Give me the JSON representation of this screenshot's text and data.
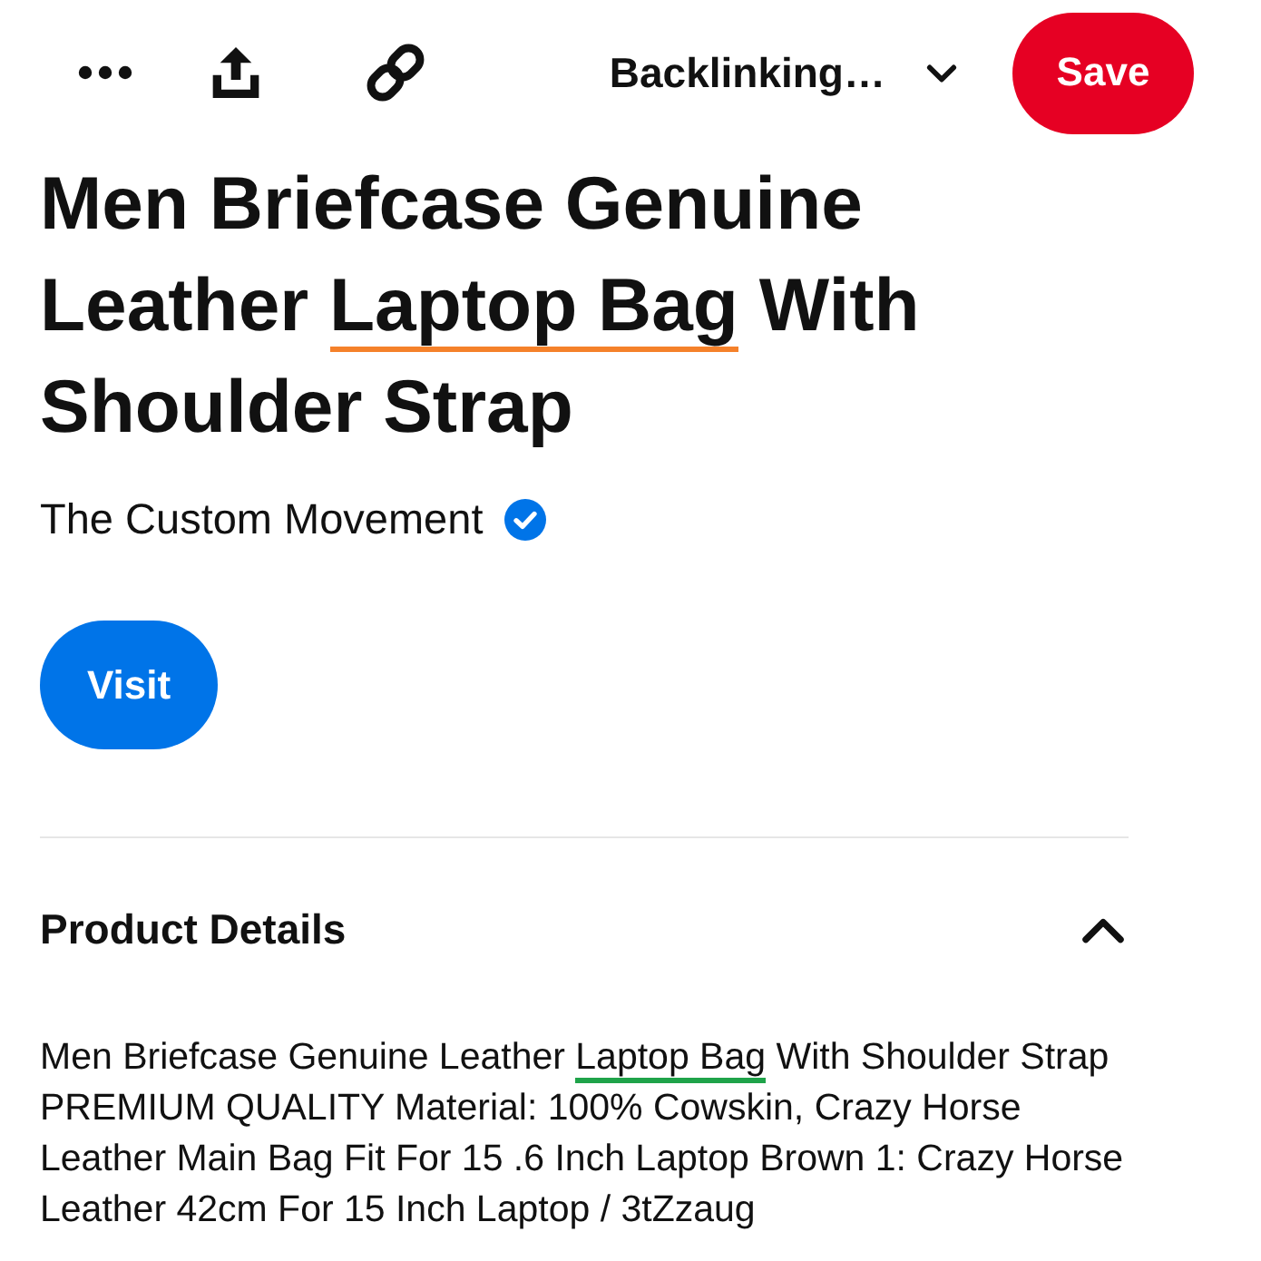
{
  "toolbar": {
    "board_selector": "Backlinking…",
    "save_button": "Save"
  },
  "pin": {
    "title": [
      {
        "kind": "plain",
        "text": "Men Briefcase Genuine Leather "
      },
      {
        "kind": "keyword",
        "text": "Laptop Bag",
        "color": "#f5812a"
      },
      {
        "kind": "plain",
        "text": " With Shoulder Strap"
      }
    ],
    "author": {
      "name": "The Custom Movement",
      "verified": true
    },
    "visit_button": "Visit"
  },
  "product_details": {
    "heading": "Product Details",
    "expanded": true,
    "description": [
      {
        "kind": "plain",
        "text": "Men Briefcase Genuine Leather "
      },
      {
        "kind": "keyword",
        "text": "Laptop Bag",
        "color": "#1fa34a"
      },
      {
        "kind": "plain",
        "text": " With Shoulder Strap PREMIUM QUALITY Material: 100% Cowskin, Crazy Horse Leather Main Bag Fit For 15 .6 Inch Laptop Brown 1: Crazy Horse Leather 42cm For 15 Inch Laptop / 3tZzaug"
      }
    ]
  }
}
